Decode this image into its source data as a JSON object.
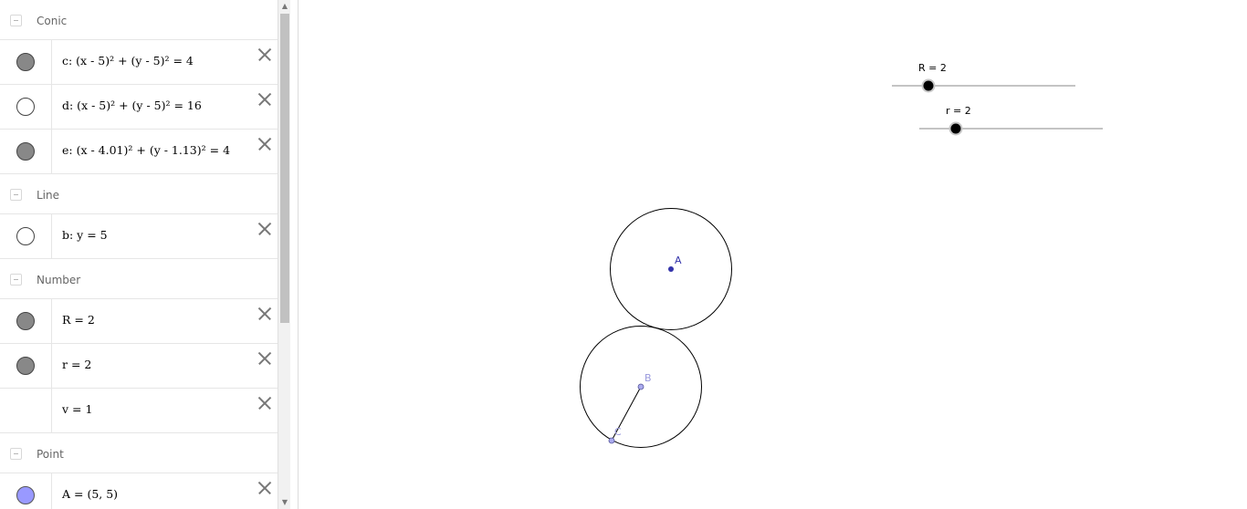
{
  "colors": {
    "marble_filled": "#888888",
    "marble_empty": "#ffffff",
    "marble_point": "#9999ff",
    "point_A": "#3333aa",
    "point_BC": "#7777cc",
    "label_BC": "#9999dd"
  },
  "algebra": {
    "groups": [
      {
        "label": "Conic",
        "items": [
          {
            "def": "c: (x - 5)² + (y - 5)² = 4",
            "marble": "filled",
            "deletable": true
          },
          {
            "def": "d: (x - 5)² + (y - 5)² = 16",
            "marble": "empty",
            "deletable": true
          },
          {
            "def": "e: (x - 4.01)² + (y - 1.13)² = 4",
            "marble": "filled",
            "deletable": true
          }
        ]
      },
      {
        "label": "Line",
        "items": [
          {
            "def": "b: y = 5",
            "marble": "empty",
            "deletable": true
          }
        ]
      },
      {
        "label": "Number",
        "items": [
          {
            "def": "R = 2",
            "marble": "filled",
            "deletable": true
          },
          {
            "def": "r = 2",
            "marble": "filled",
            "deletable": true
          },
          {
            "def": "v = 1",
            "marble": "none",
            "deletable": true
          }
        ]
      },
      {
        "label": "Point",
        "items": [
          {
            "def": "A = (5, 5)",
            "marble": "point",
            "deletable": true
          }
        ]
      }
    ]
  },
  "scroll_icons": {
    "up": "scroll-up-arrow-icon",
    "down": "scroll-down-arrow-icon"
  },
  "sliders": [
    {
      "label": "R = 2",
      "value": 2
    },
    {
      "label": "r = 2",
      "value": 2
    }
  ],
  "points": {
    "A": "A",
    "B": "B",
    "C": "C"
  }
}
